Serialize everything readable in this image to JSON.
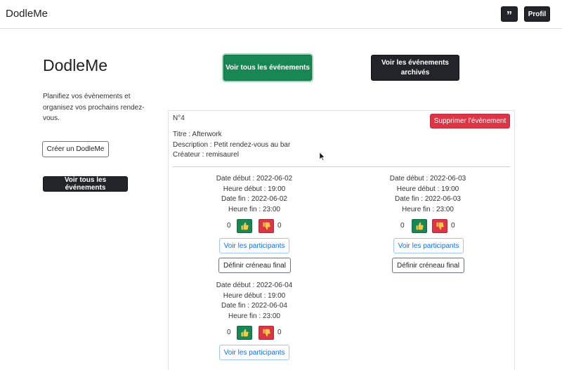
{
  "navbar": {
    "brand": "DodleMe",
    "icon_button": "”",
    "profile_label": "Profil"
  },
  "hero": {
    "title": "DodleMe",
    "description": "Planifiez vos évènements et organisez vos prochains rendez-vous.",
    "create_button": "Créer un DodleMe",
    "view_all_button": "Voir tous les événements"
  },
  "top_actions": {
    "view_all": "Voir tous les événements",
    "view_archived": "Voir les événements archivés"
  },
  "event": {
    "number": "N°4",
    "delete_button": "Supprimer l'évènement",
    "title": "Titre : Afterwork",
    "description": "Description : Petit rendez-vous au bar",
    "creator": "Créateur : remisaurel",
    "slots": [
      {
        "start_date": "Date début : 2022-06-02",
        "start_time": "Heure début : 19:00",
        "end_date": "Date fin : 2022-06-02",
        "end_time": "Heure fin : 23:00",
        "likes": "0",
        "dislikes": "0",
        "participants_button": "Voir les participants",
        "final_button": "Définir créneau final"
      },
      {
        "start_date": "Date début : 2022-06-03",
        "start_time": "Heure début : 19:00",
        "end_date": "Date fin : 2022-06-03",
        "end_time": "Heure fin : 23:00",
        "likes": "0",
        "dislikes": "0",
        "participants_button": "Voir les participants",
        "final_button": "Définir créneau final"
      },
      {
        "start_date": "Date début : 2022-06-04",
        "start_time": "Heure début : 19:00",
        "end_date": "Date fin : 2022-06-04",
        "end_time": "Heure fin : 23:00",
        "likes": "0",
        "dislikes": "0",
        "participants_button": "Voir les participants"
      }
    ]
  },
  "colors": {
    "success": "#198754",
    "danger": "#dc3545",
    "dark": "#212529",
    "primary": "#0d6efd"
  },
  "icons": {
    "like": "thumbs-up-icon",
    "dislike": "thumbs-down-icon",
    "quote": "quote-icon"
  }
}
